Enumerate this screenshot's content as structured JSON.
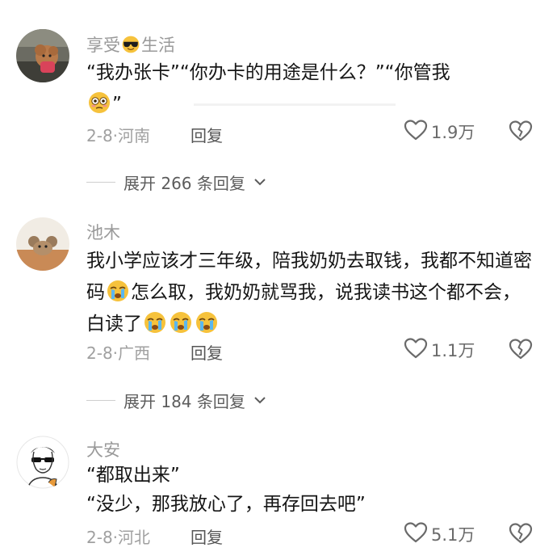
{
  "top_cut_text": "",
  "comments": [
    {
      "username_prefix": "享受",
      "username_suffix": "生活",
      "username_emoji": "sunglasses-emoji",
      "text_line1": "“我办张卡”“你办卡的用途是什么？”“你管我",
      "text_line2_after_emoji": "”",
      "text_emoji": "flushed-emoji",
      "date": "2-8",
      "location": "河南",
      "reply_label": "回复",
      "like_count": "1.9万",
      "expand_label": "展开 266 条回复",
      "avatar": "poodle-avatar"
    },
    {
      "username": "池木",
      "text_part1": "我小学应该才三年级，陪我奶奶去取钱，我都不知道密码",
      "text_part2": "怎么取，我奶奶就骂我，说我读书这个都不会，白读了",
      "text_emoji": "crying-emoji",
      "date": "2-8",
      "location": "广西",
      "reply_label": "回复",
      "like_count": "1.1万",
      "expand_label": "展开 184 条回复",
      "avatar": "cartoon-mouse-avatar"
    },
    {
      "username": "大安",
      "text_line1": "“都取出来”",
      "text_line2": "“没少，那我放心了，再存回去吧”",
      "date": "2-8",
      "location": "河北",
      "reply_label": "回复",
      "like_count": "5.1万",
      "avatar": "sketch-man-sunglasses-avatar"
    }
  ],
  "meta_separator": "·",
  "colors": {
    "text": "#161616",
    "username": "#9a9a9a",
    "meta": "#a0a0a0",
    "icon": "#6a6a6a"
  }
}
